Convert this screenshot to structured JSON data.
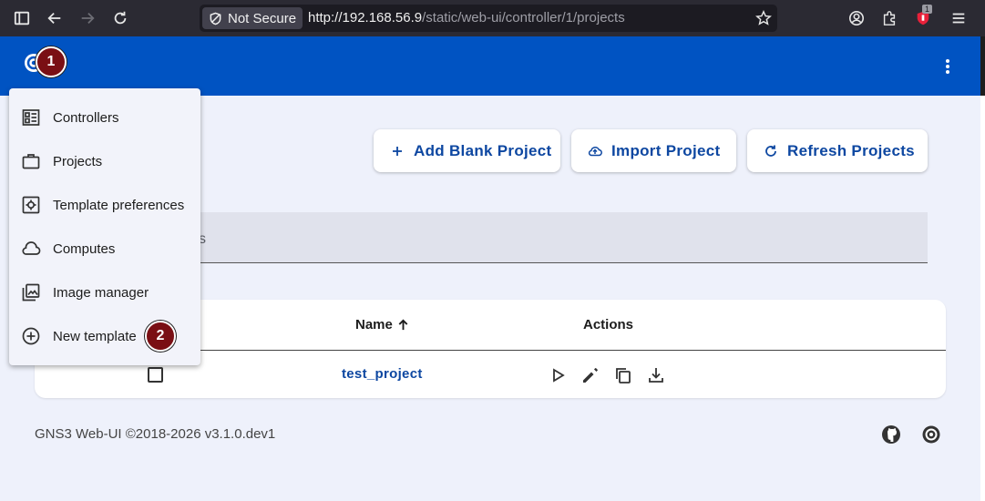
{
  "browser": {
    "security_label": "Not Secure",
    "url_host": "http://192.168.56.9",
    "url_path": "/static/web-ui/controller/1/projects",
    "extension_badge": "1"
  },
  "app": {
    "brand_color": "#0053c2",
    "more_menu_icon": "more-vert-icon"
  },
  "markers": [
    "1",
    "2"
  ],
  "actions": {
    "add_blank": "Add Blank Project",
    "import": "Import Project",
    "refresh": "Refresh Projects"
  },
  "filter": {
    "placeholder_visible": "s"
  },
  "table": {
    "col_name": "Name",
    "col_actions": "Actions",
    "rows": [
      {
        "name": "test_project"
      }
    ]
  },
  "footer": {
    "text": "GNS3 Web-UI ©2018-2026 v3.1.0.dev1"
  },
  "menu": {
    "items": [
      {
        "label": "Controllers",
        "icon": "dashboard-icon"
      },
      {
        "label": "Projects",
        "icon": "work-icon"
      },
      {
        "label": "Template preferences",
        "icon": "settings-applications-icon"
      },
      {
        "label": "Computes",
        "icon": "cloud-icon"
      },
      {
        "label": "Image manager",
        "icon": "photo-library-icon"
      },
      {
        "label": "New template",
        "icon": "add-circle-icon"
      }
    ]
  }
}
